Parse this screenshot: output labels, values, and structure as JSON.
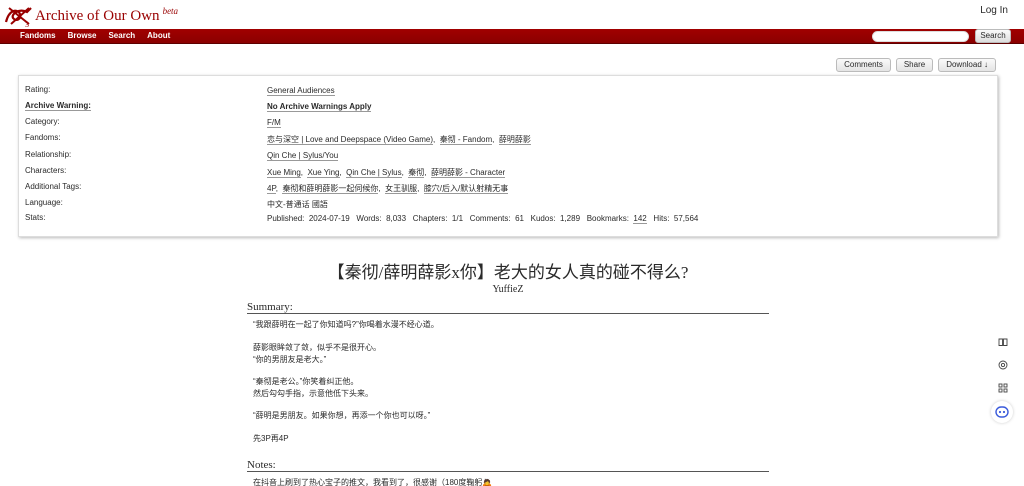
{
  "header": {
    "site_title": "Archive of Our Own",
    "beta": "beta",
    "login": "Log In"
  },
  "nav": {
    "items": [
      "Fandoms",
      "Browse",
      "Search",
      "About"
    ],
    "search_button": "Search"
  },
  "actions": [
    "Comments",
    "Share",
    "Download ↓"
  ],
  "meta": {
    "labels": {
      "rating": "Rating:",
      "warning": "Archive Warning:",
      "category": "Category:",
      "fandoms": "Fandoms:",
      "relationship": "Relationship:",
      "characters": "Characters:",
      "additional_tags": "Additional Tags:",
      "language": "Language:",
      "stats": "Stats:"
    },
    "rating": "General Audiences",
    "warning": "No Archive Warnings Apply",
    "category": "F/M",
    "fandoms": [
      "恋与深空 | Love and Deepspace (Video Game)",
      "秦彻 - Fandom",
      "薛明薛影"
    ],
    "relationship": [
      "Qin Che | Sylus/You"
    ],
    "characters": [
      "Xue Ming",
      "Xue Ying",
      "Qin Che | Sylus",
      "秦彻",
      "薛明薛影 - Character"
    ],
    "additional_tags": [
      "4P",
      "秦彻和薛明薛影一起伺候你",
      "女王驯服",
      "膝穴/后入/默认射精无事"
    ],
    "language": "中文-普通话 國語",
    "stats": {
      "published_label": "Published:",
      "published": "2024-07-19",
      "words_label": "Words:",
      "words": "8,033",
      "chapters_label": "Chapters:",
      "chapters": "1/1",
      "comments_label": "Comments:",
      "comments": "61",
      "kudos_label": "Kudos:",
      "kudos": "1,289",
      "bookmarks_label": "Bookmarks:",
      "bookmarks": "142",
      "hits_label": "Hits:",
      "hits": "57,564"
    }
  },
  "work": {
    "title": "【秦彻/薛明薛影x你】老大的女人真的碰不得么?",
    "author": "YuffieZ",
    "summary_heading": "Summary:",
    "summary": [
      "“我跟薛明在一起了你知道吗?”你喝着水漫不经心道。",
      "薛影眼眸敛了敛，似乎不是很开心。",
      "“你的男朋友是老大。”",
      "“秦彻是老公。”你笑着纠正他。",
      "然后勾勾手指，示意他低下头来。",
      "“薛明是男朋友。如果你想，再添一个你也可以呀。”",
      "先3P再4P"
    ],
    "notes_heading": "Notes:",
    "notes": [
      "在抖音上刷到了热心宝子的推文，我看到了，很感谢（180度鞠躬🙇"
    ]
  },
  "side_buttons": [
    "book-icon",
    "target-icon",
    "grid-icon",
    "assistant-icon"
  ],
  "colors": {
    "brand": "#990000",
    "nav_bg": "#990000"
  }
}
